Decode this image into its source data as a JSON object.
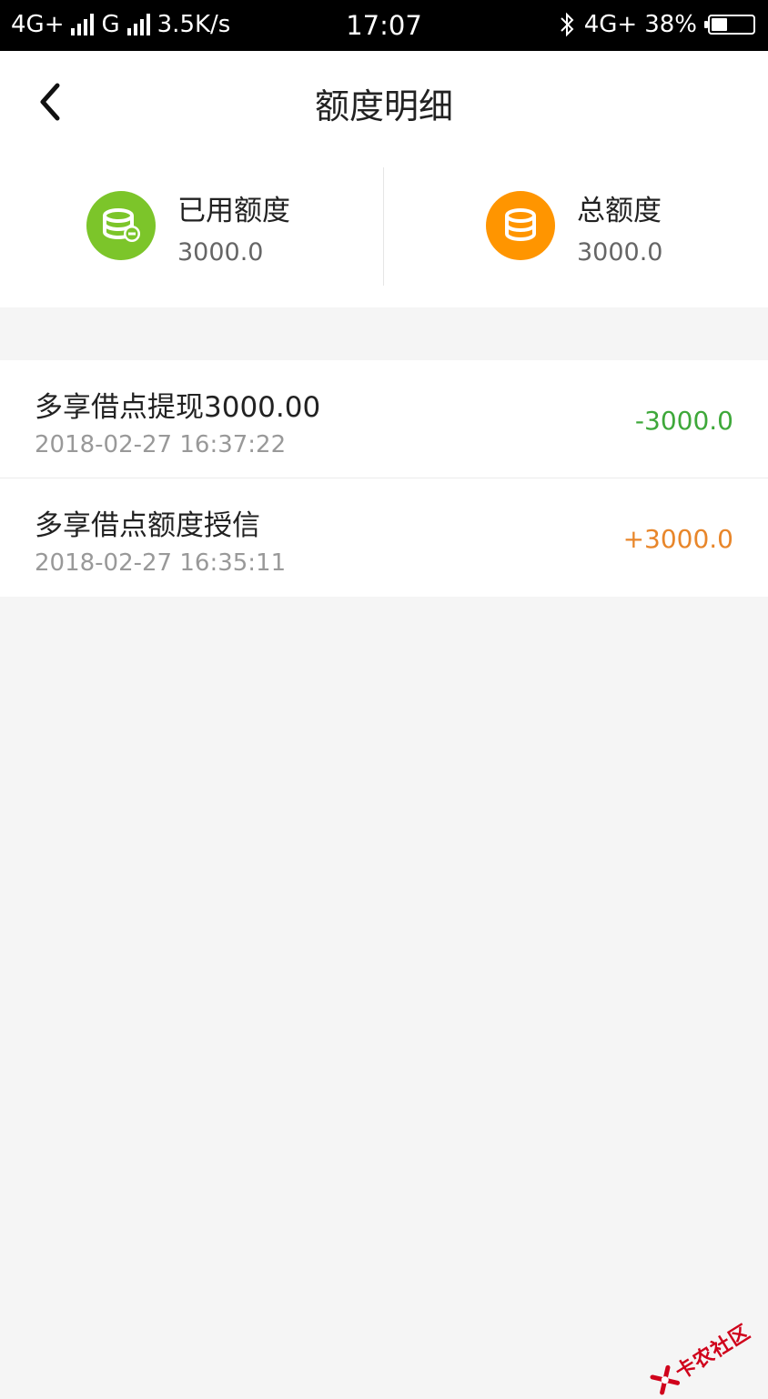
{
  "status_bar": {
    "network_1": "4G+",
    "network_2": "G",
    "speed": "3.5K/s",
    "time": "17:07",
    "network_3": "4G",
    "network_3_suffix": "+",
    "battery": "38%",
    "battery_level": 0.38
  },
  "nav": {
    "back_icon": "chevron-left-icon",
    "title": "额度明细"
  },
  "summary": {
    "used": {
      "label": "已用额度",
      "value": "3000.0",
      "icon": "coins-minus-icon",
      "color": "#7cc52a"
    },
    "total": {
      "label": "总额度",
      "value": "3000.0",
      "icon": "coins-icon",
      "color": "#ff9500"
    }
  },
  "records": [
    {
      "title": "多享借点提现3000.00",
      "time": "2018-02-27 16:37:22",
      "amount": "-3000.0",
      "color": "#3ea83a"
    },
    {
      "title": "多享借点额度授信",
      "time": "2018-02-27 16:35:11",
      "amount": "+3000.0",
      "color": "#e8862a"
    }
  ],
  "watermark": {
    "text": "卡农社区",
    "icon": "logo-icon",
    "color": "#d0021b"
  },
  "colors": {
    "background": "#f5f5f5",
    "surface": "#ffffff"
  }
}
